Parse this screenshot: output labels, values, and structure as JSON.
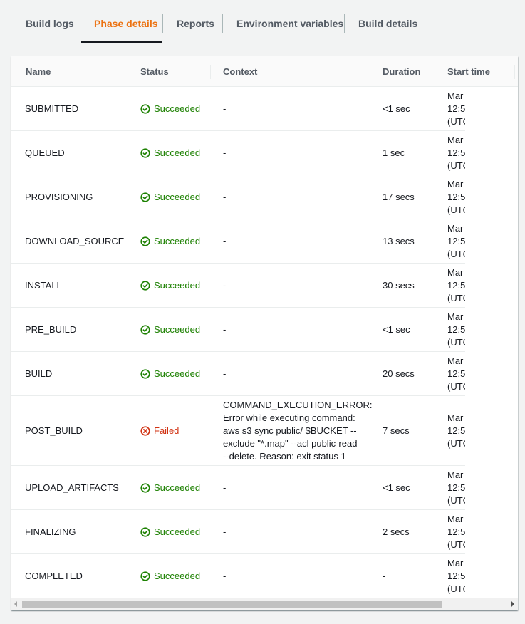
{
  "tabs": [
    {
      "label": "Build logs",
      "active": false
    },
    {
      "label": "Phase details",
      "active": true
    },
    {
      "label": "Reports",
      "active": false
    },
    {
      "label": "Environment variables",
      "active": false
    },
    {
      "label": "Build details",
      "active": false
    }
  ],
  "colors": {
    "accent": "#ec7211",
    "success": "#1d8102",
    "error": "#d13212"
  },
  "table": {
    "columns": [
      "Name",
      "Status",
      "Context",
      "Duration",
      "Start time"
    ],
    "rows": [
      {
        "name": "SUBMITTED",
        "status": "Succeeded",
        "status_icon": "check-circle-icon",
        "context": "-",
        "duration": "<1 sec",
        "start": [
          "Mar",
          "12:5",
          "(UTC"
        ]
      },
      {
        "name": "QUEUED",
        "status": "Succeeded",
        "status_icon": "check-circle-icon",
        "context": "-",
        "duration": "1 sec",
        "start": [
          "Mar",
          "12:5",
          "(UTC"
        ]
      },
      {
        "name": "PROVISIONING",
        "status": "Succeeded",
        "status_icon": "check-circle-icon",
        "context": "-",
        "duration": "17 secs",
        "start": [
          "Mar",
          "12:5",
          "(UTC"
        ]
      },
      {
        "name": "DOWNLOAD_SOURCE",
        "status": "Succeeded",
        "status_icon": "check-circle-icon",
        "context": "-",
        "duration": "13 secs",
        "start": [
          "Mar",
          "12:5",
          "(UTC"
        ]
      },
      {
        "name": "INSTALL",
        "status": "Succeeded",
        "status_icon": "check-circle-icon",
        "context": "-",
        "duration": "30 secs",
        "start": [
          "Mar",
          "12:5",
          "(UTC"
        ]
      },
      {
        "name": "PRE_BUILD",
        "status": "Succeeded",
        "status_icon": "check-circle-icon",
        "context": "-",
        "duration": "<1 sec",
        "start": [
          "Mar",
          "12:5",
          "(UTC"
        ]
      },
      {
        "name": "BUILD",
        "status": "Succeeded",
        "status_icon": "check-circle-icon",
        "context": "-",
        "duration": "20 secs",
        "start": [
          "Mar",
          "12:5",
          "(UTC"
        ]
      },
      {
        "name": "POST_BUILD",
        "status": "Failed",
        "status_icon": "x-circle-icon",
        "context": "COMMAND_EXECUTION_ERROR: Error while executing command: aws s3 sync public/ $BUCKET --exclude \"*.map\" --acl public-read --delete. Reason: exit status 1",
        "duration": "7 secs",
        "start": [
          "Mar",
          "12:5",
          "(UTC"
        ]
      },
      {
        "name": "UPLOAD_ARTIFACTS",
        "status": "Succeeded",
        "status_icon": "check-circle-icon",
        "context": "-",
        "duration": "<1 sec",
        "start": [
          "Mar",
          "12:5",
          "(UTC"
        ]
      },
      {
        "name": "FINALIZING",
        "status": "Succeeded",
        "status_icon": "check-circle-icon",
        "context": "-",
        "duration": "2 secs",
        "start": [
          "Mar",
          "12:5",
          "(UTC"
        ]
      },
      {
        "name": "COMPLETED",
        "status": "Succeeded",
        "status_icon": "check-circle-icon",
        "context": "-",
        "duration": "-",
        "start": [
          "Mar",
          "12:5",
          "(UTC"
        ]
      }
    ]
  }
}
